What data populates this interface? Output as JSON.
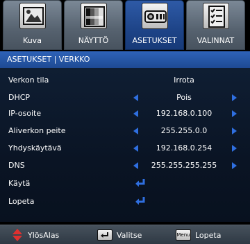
{
  "tabs": [
    {
      "label": "Kuva",
      "icon": "picture-icon"
    },
    {
      "label": "NÄYTTÖ",
      "icon": "display-icon"
    },
    {
      "label": "ASETUKSET",
      "icon": "projector-settings-icon"
    },
    {
      "label": "VALINNAT",
      "icon": "options-icon"
    }
  ],
  "active_tab": "ASETUKSET",
  "breadcrumb": "ASETUKSET | VERKKO",
  "rows": [
    {
      "name": "Verkon tila",
      "value": "Irrota"
    },
    {
      "name": "DHCP",
      "value": "Pois"
    },
    {
      "name": "IP-osoite",
      "value": "192.168.0.100"
    },
    {
      "name": "Aliverkon peite",
      "value": "255.255.0.0"
    },
    {
      "name": "Yhdyskäytävä",
      "value": "192.168.0.254"
    },
    {
      "name": "DNS",
      "value": "255.255.255.255"
    },
    {
      "name": "Käytä",
      "value": ""
    },
    {
      "name": "Lopeta",
      "value": ""
    }
  ],
  "footer": {
    "updown_label": "YlösAlas",
    "select_label": "Valitse",
    "menu_key_label": "Menu",
    "exit_label": "Lopeta"
  },
  "colors": {
    "accent": "#2f6fe0",
    "title_bar": "#2e63b8",
    "footer_arrows": "#e0302f"
  }
}
